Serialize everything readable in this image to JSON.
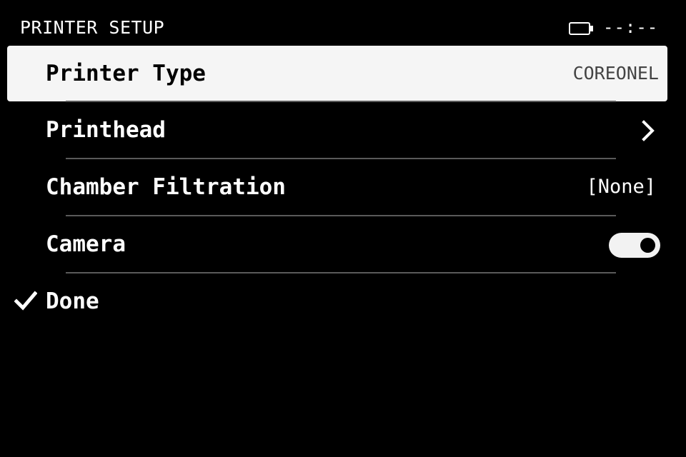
{
  "header": {
    "title": "PRINTER SETUP",
    "clock": "--:--",
    "battery_icon": "battery-icon"
  },
  "menu": {
    "printer_type": {
      "label": "Printer Type",
      "value": "COREONEL",
      "selected": true
    },
    "printhead": {
      "label": "Printhead",
      "icon": "chevron-right-icon"
    },
    "chamber_filtration": {
      "label": "Chamber Filtration",
      "value": "[None]"
    },
    "camera": {
      "label": "Camera",
      "toggle_on": true
    },
    "done": {
      "label": "Done",
      "icon": "checkmark-icon"
    }
  },
  "colors": {
    "background": "#000000",
    "selected_row": "#f5f5f5",
    "divider": "#5a5a5a"
  }
}
